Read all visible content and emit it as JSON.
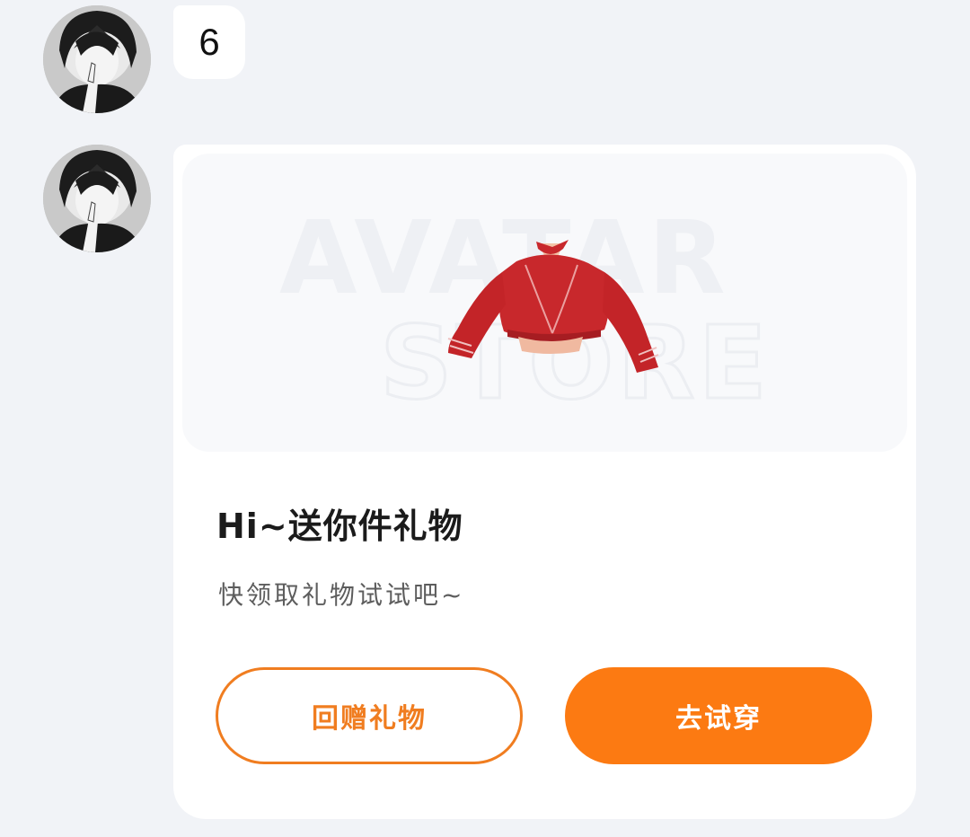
{
  "chat": {
    "messages": [
      {
        "type": "text",
        "text": "6"
      },
      {
        "type": "gift",
        "banner_watermark": [
          "AVATAR",
          "STORE"
        ],
        "title": "Hi~送你件礼物",
        "subtitle": "快领取礼物试试吧~",
        "return_gift_label": "回赠礼物",
        "try_on_label": "去试穿"
      }
    ]
  },
  "colors": {
    "accent": "#fc7a12",
    "accent_border": "#f07d20",
    "page_background": "#f1f3f7",
    "card_background": "#ffffff",
    "banner_background": "#f8f9fb",
    "gift_item": "#c8282c"
  },
  "icons": {
    "avatar": "anime-portrait",
    "gift_item": "red-cropped-sweater"
  }
}
